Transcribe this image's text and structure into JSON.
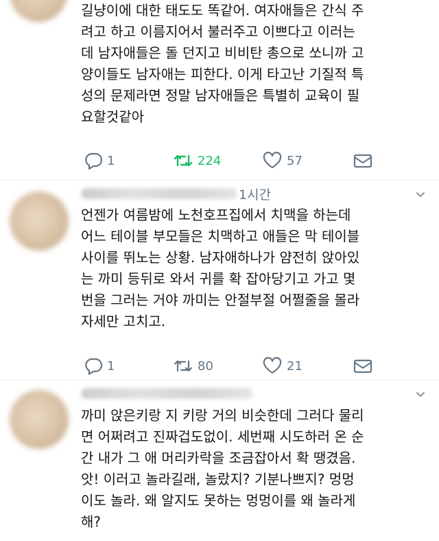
{
  "tweets": [
    {
      "time": "",
      "text": "길냥이에 대한 태도도 똑같어. 여자애들은 간식 주\n려고 하고 이름지어서 불러주고 이쁘다고 이러는\n데 남자애들은 돌 던지고 비비탄 총으로 쏘니까 고\n양이들도 남자애는 피한다. 이게 타고난 기질적 특\n성의 문제라면 정말 남자애들은 특별히 교육이 필\n요할것같아",
      "reply_count": "1",
      "retweet_count": "224",
      "like_count": "57",
      "retweeted": true
    },
    {
      "time": "1시간",
      "text": "언젠가 여름밤에 노천호프집에서 치맥을 하는데\n어느 테이블 부모들은 치맥하고 애들은 막 테이블\n사이를 뛰노는 상황. 남자애하나가 얌전히 앉아있\n는 까미 등뒤로 와서 귀를 확 잡아당기고 가고 몇\n번을 그러는 거야 까미는 안절부절 어쩔줄을 몰라\n자세만 고치고.",
      "reply_count": "1",
      "retweet_count": "80",
      "like_count": "21",
      "retweeted": false
    },
    {
      "time": "",
      "text": "까미 앉은키랑 지 키랑 거의 비슷한데 그러다 물리\n면 어쩌려고 진짜겁도없이. 세번째 시도하러 온 순\n간 내가 그 애 머리카락을 조금잡아서 확 땡겼음.\n앗! 이러고 놀라길래, 놀랐지? 기분나쁘지? 멍멍\n이도 놀라. 왜 알지도 못하는 멍멍이를 왜 놀라게\n해?",
      "reply_count": "",
      "retweet_count": "",
      "like_count": "",
      "retweeted": false
    }
  ],
  "colors": {
    "text": "#14171a",
    "muted": "#657786",
    "retweet_active": "#17bf63",
    "divider": "#e6ecf0"
  },
  "icons": {
    "reply": "reply-icon",
    "retweet": "retweet-icon",
    "like": "heart-icon",
    "dm": "envelope-icon",
    "more": "chevron-down-icon"
  }
}
